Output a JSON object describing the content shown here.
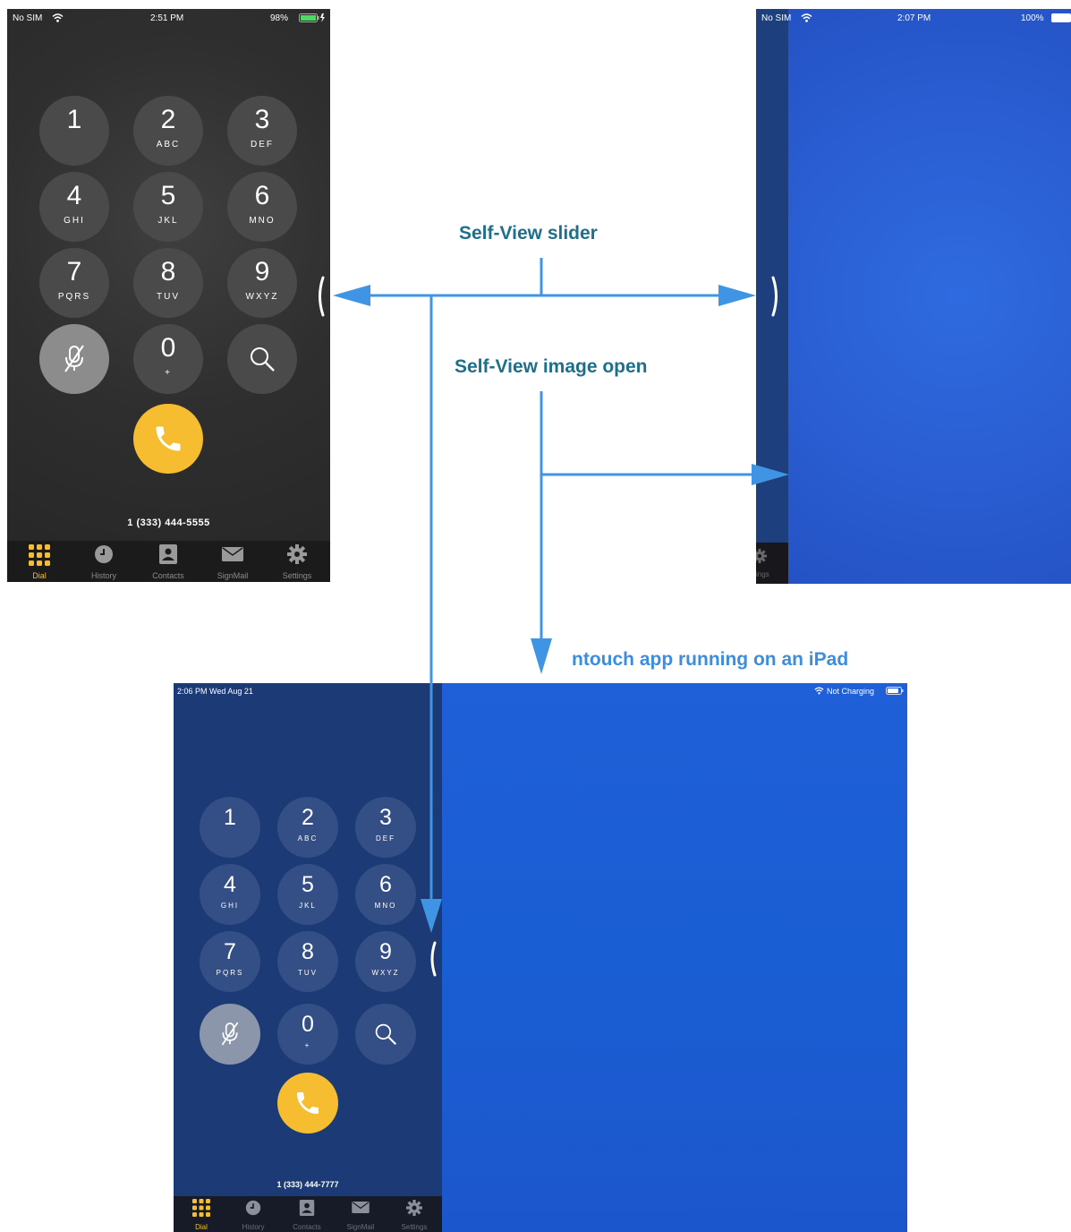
{
  "annotations": {
    "self_view_slider": "Self-View slider",
    "self_view_image_open": "Self-View image open",
    "ipad_caption": "ntouch app running on an iPad",
    "label_color": "#1e6f8c",
    "caption_color": "#3c8dde",
    "arrow_color": "#3f95e3"
  },
  "phone1": {
    "status": {
      "carrier": "No SIM",
      "time": "2:51 PM",
      "battery": "98%"
    },
    "keys": [
      {
        "digit": "1",
        "letters": ""
      },
      {
        "digit": "2",
        "letters": "ABC"
      },
      {
        "digit": "3",
        "letters": "DEF"
      },
      {
        "digit": "4",
        "letters": "GHI"
      },
      {
        "digit": "5",
        "letters": "JKL"
      },
      {
        "digit": "6",
        "letters": "MNO"
      },
      {
        "digit": "7",
        "letters": "PQRS"
      },
      {
        "digit": "8",
        "letters": "TUV"
      },
      {
        "digit": "9",
        "letters": "WXYZ"
      },
      {
        "digit": "0",
        "letters": "+"
      }
    ],
    "number": "1 (333) 444-5555",
    "tabs": [
      "Dial",
      "History",
      "Contacts",
      "SignMail",
      "Settings"
    ],
    "active_tab": "Dial"
  },
  "phone2": {
    "status": {
      "carrier": "No SIM",
      "time": "2:07 PM",
      "battery": "100%"
    },
    "partial_tab": "ings"
  },
  "ipad": {
    "status": {
      "time_date": "2:06 PM   Wed Aug 21",
      "charging": "Not Charging"
    },
    "keys": [
      {
        "digit": "1",
        "letters": ""
      },
      {
        "digit": "2",
        "letters": "ABC"
      },
      {
        "digit": "3",
        "letters": "DEF"
      },
      {
        "digit": "4",
        "letters": "GHI"
      },
      {
        "digit": "5",
        "letters": "JKL"
      },
      {
        "digit": "6",
        "letters": "MNO"
      },
      {
        "digit": "7",
        "letters": "PQRS"
      },
      {
        "digit": "8",
        "letters": "TUV"
      },
      {
        "digit": "9",
        "letters": "WXYZ"
      },
      {
        "digit": "0",
        "letters": "+"
      }
    ],
    "number": "1 (333) 444-7777",
    "tabs": [
      "Dial",
      "History",
      "Contacts",
      "SignMail",
      "Settings"
    ],
    "active_tab": "Dial"
  },
  "icons": {
    "mute": "microphone-mute-icon",
    "search": "search-icon",
    "call": "phone-handset-icon",
    "tabs": [
      "dialpad-icon",
      "clock-icon",
      "contact-card-icon",
      "envelope-icon",
      "gear-icon"
    ],
    "status": [
      "wifi-icon",
      "battery-icon",
      "charging-bolt-icon"
    ],
    "slider": "chevron-handle-icon"
  },
  "colors": {
    "call_button": "#f5bd2f",
    "active_tab": "#f5bd2f",
    "self_view": "#2f64d6"
  }
}
